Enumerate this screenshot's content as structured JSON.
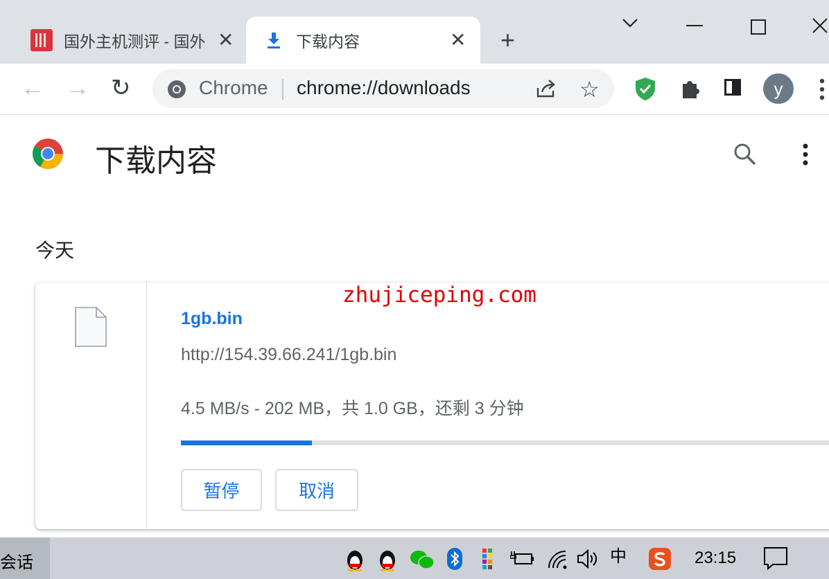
{
  "tabs": [
    {
      "title": "国外主机测评 - 国外",
      "close": "✕"
    },
    {
      "title": "下载内容",
      "close": "✕"
    }
  ],
  "new_tab": "+",
  "window_controls": {
    "tabsearch": "⌄",
    "minimize": "—",
    "maximize": "☐",
    "close": "✕"
  },
  "toolbar": {
    "back": "←",
    "forward": "→",
    "reload": "↻",
    "omni_label": "Chrome",
    "omni_url": "chrome://downloads",
    "share": "⇪",
    "star": "☆",
    "avatar": "y"
  },
  "page": {
    "title": "下载内容",
    "section": "今天"
  },
  "download": {
    "file_name": "1gb.bin",
    "url": "http://154.39.66.241/1gb.bin",
    "status": "4.5 MB/s - 202 MB，共 1.0 GB，还剩 3 分钟",
    "progress_percent": 20.2,
    "pause_label": "暂停",
    "cancel_label": "取消"
  },
  "watermark": "zhujiceping.com",
  "taskbar": {
    "item_label": "会话",
    "ime": "中",
    "clock": "23:15"
  },
  "colors": {
    "accent": "#1a73e8",
    "extension_shield": "#34a853",
    "watermark": "#e00000",
    "avatar_bg": "#6b7a86"
  }
}
